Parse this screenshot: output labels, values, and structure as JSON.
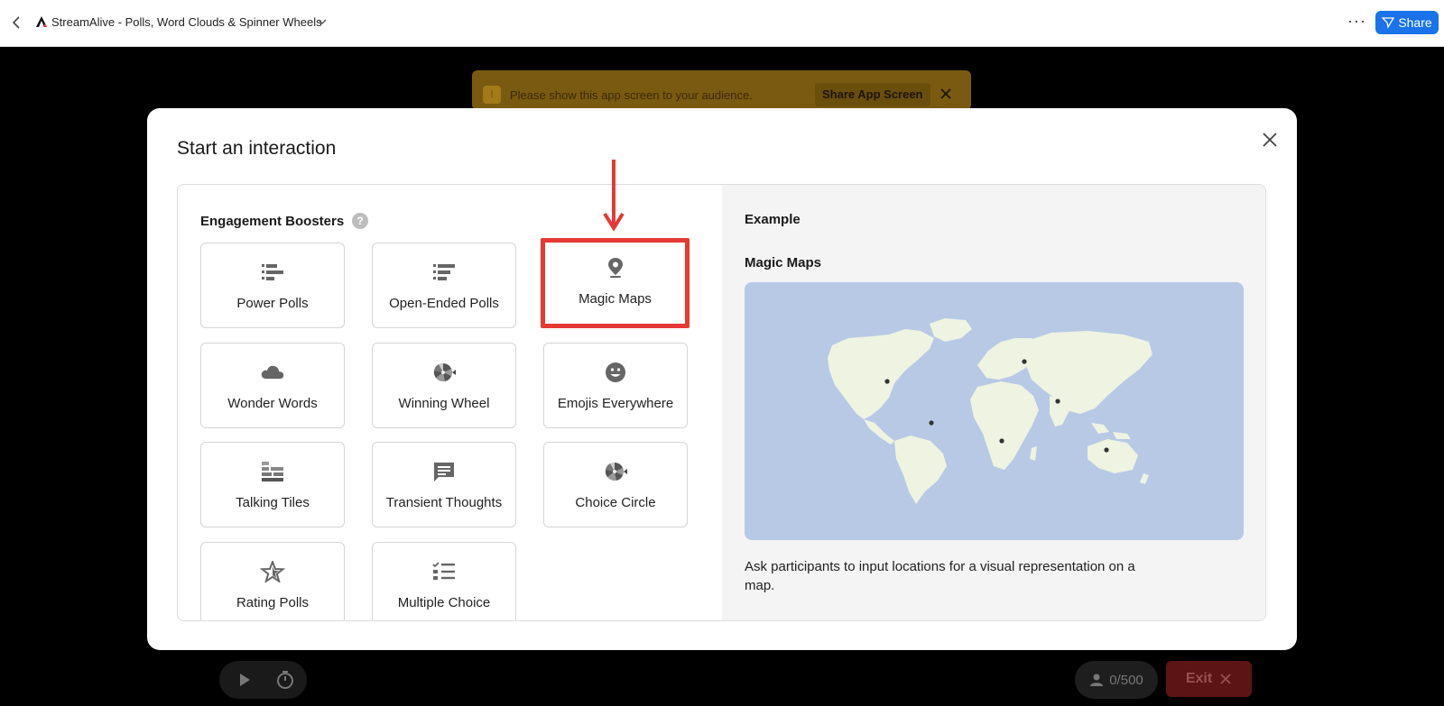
{
  "topbar": {
    "title": "StreamAlive - Polls, Word Clouds & Spinner Wheels",
    "share_label": "Share",
    "more_label": "···"
  },
  "banner": {
    "icon": "!",
    "text": "Please show this app screen to your audience.",
    "button_label": "Share App Screen"
  },
  "modal": {
    "title": "Start an interaction",
    "section_title": "Engagement Boosters",
    "help_label": "?",
    "tiles": [
      {
        "label": "Power Polls",
        "icon": "numbered-list-icon"
      },
      {
        "label": "Open-Ended Polls",
        "icon": "numbered-list-icon"
      },
      {
        "label": "Magic Maps",
        "icon": "map-pin-icon",
        "highlighted": true
      },
      {
        "label": "Wonder Words",
        "icon": "cloud-icon"
      },
      {
        "label": "Winning Wheel",
        "icon": "spinner-wheel-icon"
      },
      {
        "label": "Emojis Everywhere",
        "icon": "smiley-icon"
      },
      {
        "label": "Talking Tiles",
        "icon": "tiles-icon"
      },
      {
        "label": "Transient Thoughts",
        "icon": "chat-bubble-icon"
      },
      {
        "label": "Choice Circle",
        "icon": "spinner-wheel-icon"
      },
      {
        "label": "Rating Polls",
        "icon": "star-icon"
      },
      {
        "label": "Multiple Choice",
        "icon": "checklist-icon"
      }
    ],
    "example": {
      "heading": "Example",
      "name": "Magic Maps",
      "description": "Ask participants to input locations for a visual representation on a map."
    }
  },
  "bottombar": {
    "participant_count": "0/500",
    "exit_label": "Exit"
  },
  "colors": {
    "accent": "#1a73e8",
    "highlight": "#e53935",
    "map_water": "#b8c9e6",
    "map_land": "#eef3e2"
  }
}
